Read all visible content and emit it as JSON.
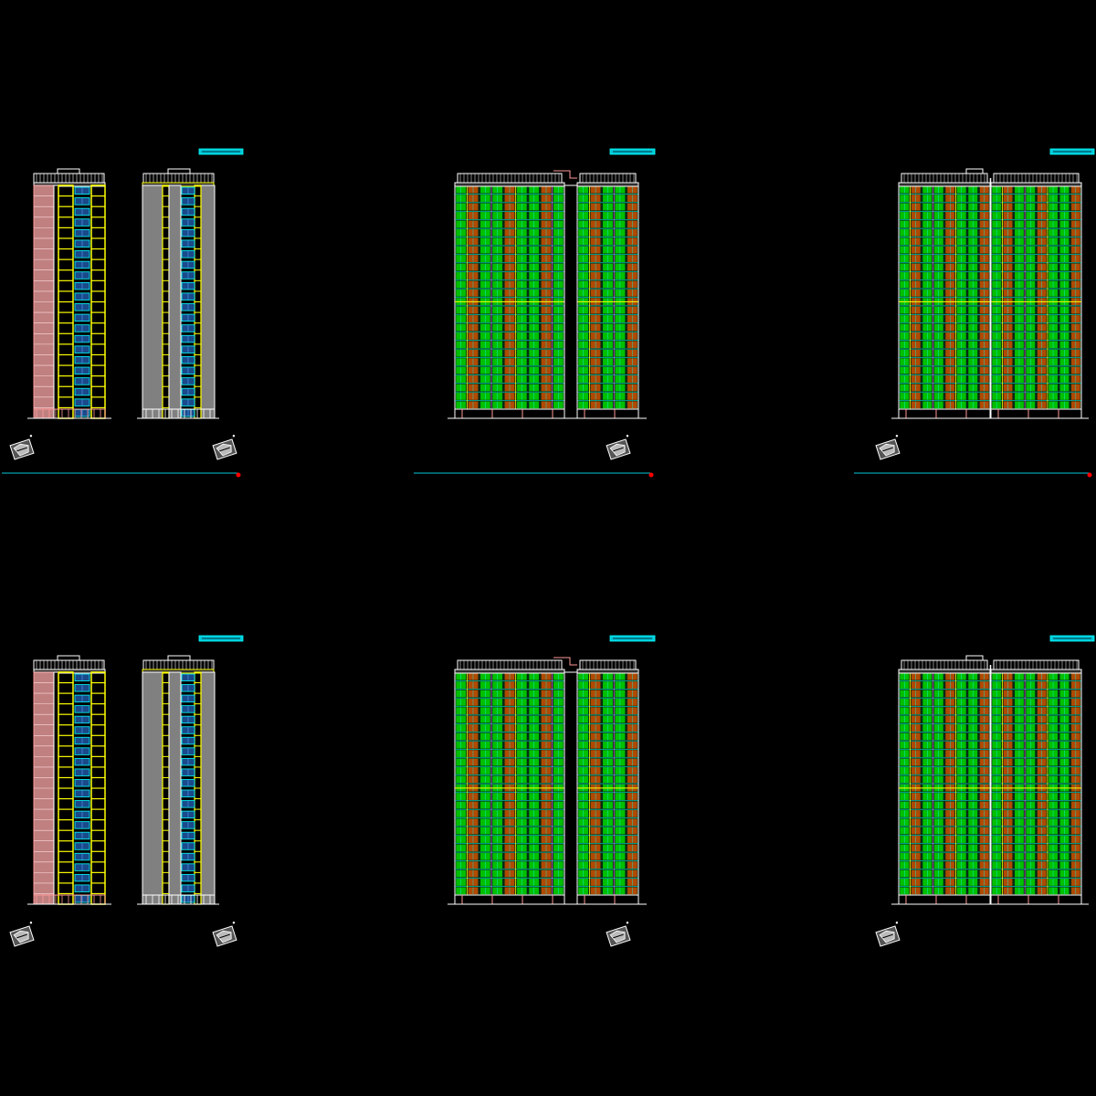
{
  "drawing": {
    "background": "#000000",
    "floors": 22,
    "colors": {
      "outline": "#ffffff",
      "balcony": "#ffff00",
      "brick": "#ff9999",
      "wall_gray": "#808080",
      "glass_blue": "#4aa3ff",
      "frame_cyan": "#00ffff",
      "green": "#00c000",
      "brown": "#b04a00",
      "magenta": "#ff66ff",
      "guide_line": "#00c8d8",
      "marker_red": "#ff0000"
    },
    "sheets": [
      {
        "id": "sheet-top-left",
        "kind": "side-pair"
      },
      {
        "id": "sheet-top-middle",
        "kind": "front-split"
      },
      {
        "id": "sheet-top-right",
        "kind": "front-joined"
      },
      {
        "id": "sheet-bottom-left",
        "kind": "side-pair"
      },
      {
        "id": "sheet-bottom-middle",
        "kind": "front-split"
      },
      {
        "id": "sheet-bottom-right",
        "kind": "front-joined"
      }
    ],
    "icons": [
      "north-arrow-icon",
      "location-marker-icon"
    ]
  }
}
